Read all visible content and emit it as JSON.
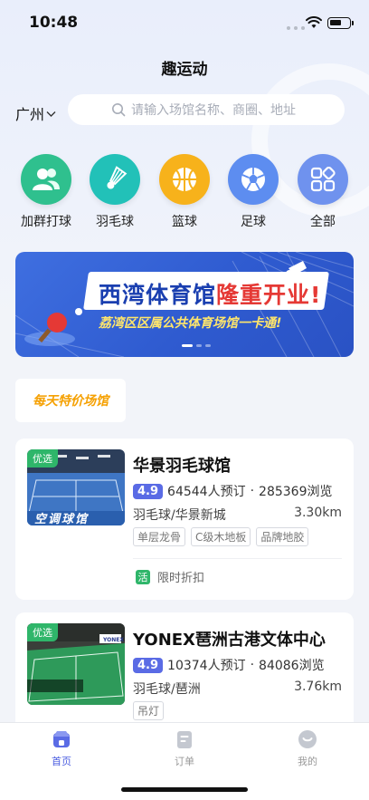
{
  "status_bar": {
    "time": "10:48"
  },
  "header": {
    "title": "趣运动"
  },
  "location": {
    "city": "广州"
  },
  "search": {
    "placeholder": "请输入场馆名称、商圈、地址"
  },
  "categories": [
    {
      "label": "加群打球",
      "icon": "group-icon",
      "color": "#2fc08e"
    },
    {
      "label": "羽毛球",
      "icon": "shuttlecock-icon",
      "color": "#22c1b8"
    },
    {
      "label": "篮球",
      "icon": "basketball-icon",
      "color": "#f7b21b"
    },
    {
      "label": "足球",
      "icon": "football-icon",
      "color": "#5d8df0"
    },
    {
      "label": "全部",
      "icon": "grid-icon",
      "color": "#6f92ee"
    }
  ],
  "banner": {
    "title_main": "西湾体育馆",
    "title_highlight": "隆重开业!",
    "subtitle": "荔湾区区属公共体育场馆一卡通!",
    "slide_count": 3,
    "active_slide": 1
  },
  "section": {
    "special_label": "每天特价场馆"
  },
  "venues": [
    {
      "badge": "优选",
      "thumb_caption": "空调球馆",
      "name": "华景羽毛球馆",
      "rating": "4.9",
      "bookings": "64544人预订",
      "views": "285369浏览",
      "sport_area": "羽毛球/华景新城",
      "distance": "3.30km",
      "tags": [
        "单层龙骨",
        "C级木地板",
        "品牌地胶"
      ],
      "promo_tag": "活",
      "promo_text": "限时折扣"
    },
    {
      "badge": "优选",
      "name": "YONEX琶洲古港文体中心",
      "rating": "4.9",
      "bookings": "10374人预订",
      "views": "84086浏览",
      "sport_area": "羽毛球/琶洲",
      "distance": "3.76km",
      "tags": [
        "吊灯"
      ]
    }
  ],
  "tabbar": [
    {
      "label": "首页",
      "icon": "home-icon",
      "active": true
    },
    {
      "label": "订单",
      "icon": "order-icon",
      "active": false
    },
    {
      "label": "我的",
      "icon": "profile-icon",
      "active": false
    }
  ],
  "colors": {
    "accent": "#4a5de0",
    "green": "#2fb66a",
    "banner_blue": "#3461d6"
  }
}
